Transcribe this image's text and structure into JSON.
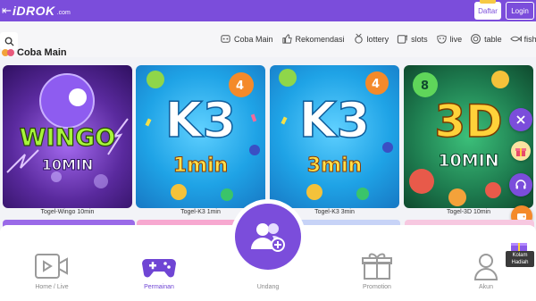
{
  "header": {
    "back_icon": "back-arrow-icon",
    "logo_text": "iDROK",
    "logo_suffix": ".com",
    "register_label": "Daftar",
    "login_label": "Login"
  },
  "nav": {
    "search_icon": "search-icon",
    "categories": [
      {
        "label": "Coba Main",
        "icon": "toys-icon"
      },
      {
        "label": "Rekomendasi",
        "icon": "thumbs-up-icon"
      },
      {
        "label": "lottery",
        "icon": "medal-icon"
      },
      {
        "label": "slots",
        "icon": "slot-machine-icon"
      },
      {
        "label": "live",
        "icon": "mask-icon"
      },
      {
        "label": "table",
        "icon": "chip-icon"
      },
      {
        "label": "fish",
        "icon": "fish-icon"
      }
    ]
  },
  "section": {
    "title": "Coba Main"
  },
  "games": [
    {
      "name": "Togel-Wingo 10min",
      "art_line1": "WINGO",
      "art_line2": "10MIN"
    },
    {
      "name": "Togel-K3 1min",
      "art_line1": "K3",
      "art_line2": "1min"
    },
    {
      "name": "Togel-K3 3min",
      "art_line1": "K3",
      "art_line2": "3min"
    },
    {
      "name": "Togel-3D 10min",
      "art_line1": "3D",
      "art_line2": "10MIN"
    }
  ],
  "side": {
    "kolam_label_line1": "Kolam",
    "kolam_label_line2": "Hadiah"
  },
  "bottom_nav": [
    {
      "label": "Home / Live",
      "icon": "video-icon",
      "active": false
    },
    {
      "label": "Permainan",
      "icon": "gamepad-icon",
      "active": true
    },
    {
      "label": "Undang",
      "icon": "invite-users-icon",
      "active": false
    },
    {
      "label": "Promotion",
      "icon": "gift-icon",
      "active": false
    },
    {
      "label": "Akun",
      "icon": "user-icon",
      "active": false
    }
  ],
  "colors": {
    "brand": "#7b4ddb",
    "active_tab": "#6f45d4",
    "k3_blue": "#1fa3e6",
    "wingo_purple": "#5a2a9e",
    "three_d_green": "#1d7a4e"
  }
}
